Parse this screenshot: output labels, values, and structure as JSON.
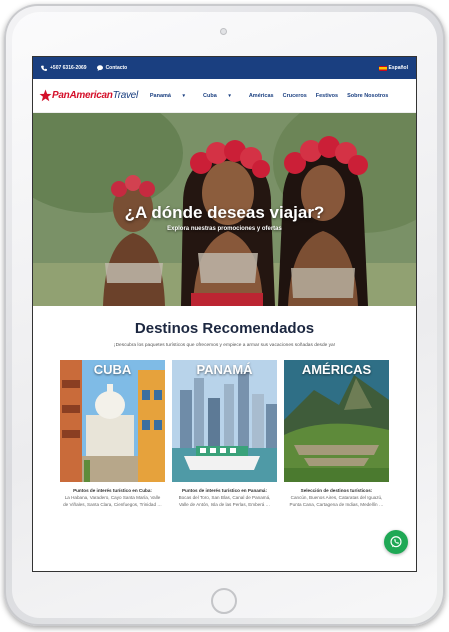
{
  "topbar": {
    "phone": "+507 6316-2069",
    "contact": "Contacto",
    "language": "Español"
  },
  "logo": {
    "part1": "PanAmerican",
    "part2": "Travel"
  },
  "nav": {
    "items": [
      "Panamá",
      "Cuba",
      "Américas",
      "Cruceros",
      "Festivos",
      "Sobre Nosotros"
    ]
  },
  "hero": {
    "title": "¿A dónde deseas viajar?",
    "subtitle": "Explora nuestras promociones y ofertas"
  },
  "destinos": {
    "title": "Destinos Recomendados",
    "subtitle": "¡Descubra los paquetes turísticos que ofrecemos y empiece a armar sus vacaciones soñadas desde ya!",
    "cards": [
      {
        "title": "CUBA",
        "caption": "Puntos de interés turístico en Cuba:",
        "desc": "La Habana, Varadero, Cayo Santa María, Valle de Viñales, Santa Clara, Cienfuegos, Trinidad …"
      },
      {
        "title": "PANAMÁ",
        "caption": "Puntos de interés turístico en Panamá:",
        "desc": "Bocas del Toro, San Blas, Canal de Panamá, Valle de Antón, Isla de las Perlas, Emberá …"
      },
      {
        "title": "AMÉRICAS",
        "caption": "Selección de destinos turísticos:",
        "desc": "Cancún, Buenos Aires, Cataratas del Iguazú, Punta Cana, Cartagena de Indias, Medellín …"
      }
    ]
  },
  "icons": {
    "phone": "phone-icon",
    "contact": "chat-icon",
    "flag": "spain-flag-icon",
    "chevron": "chevron-down-icon",
    "whatsapp": "whatsapp-icon",
    "logo_star": "star-icon"
  },
  "colors": {
    "brand_blue": "#1a3f80",
    "brand_red": "#d4102a",
    "heading": "#1c2740",
    "whatsapp": "#1fa855"
  }
}
